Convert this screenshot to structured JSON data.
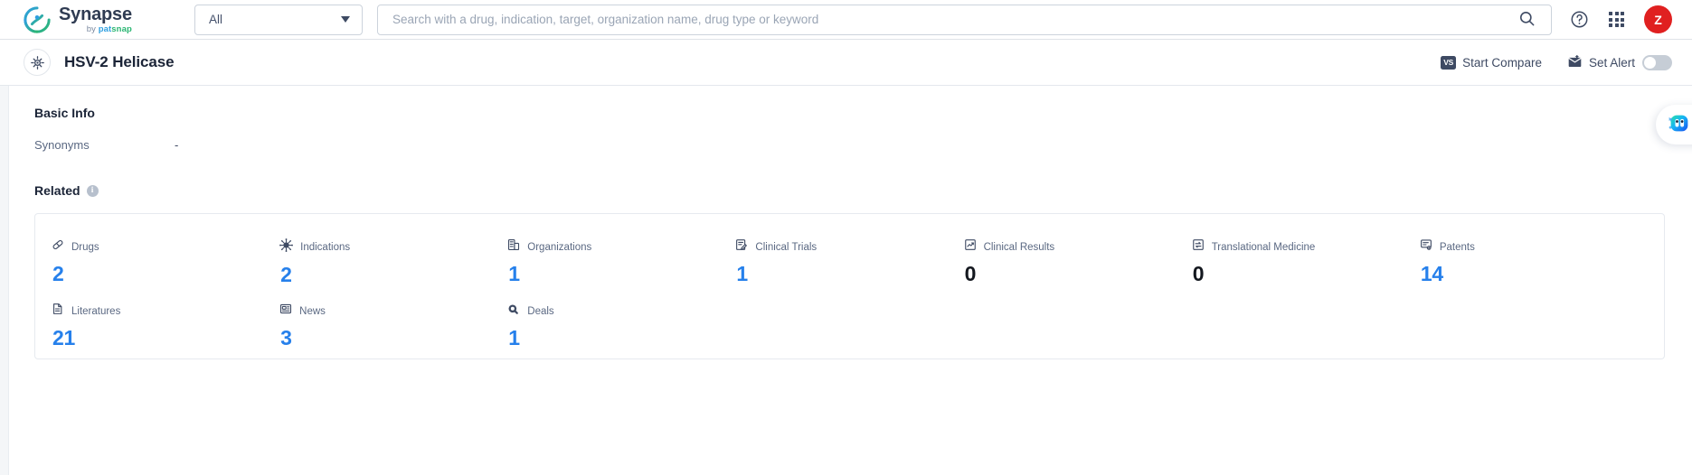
{
  "header": {
    "logo_name": "Synapse",
    "logo_sub_prefix": "by ",
    "logo_sub_brand_a": "pat",
    "logo_sub_brand_b": "snap",
    "scope_selected": "All",
    "search_placeholder": "Search with a drug, indication, target, organization name, drug type or keyword",
    "search_value": "",
    "search_icon": "search-icon",
    "help_icon": "help-circle-icon",
    "apps_icon": "apps-grid-icon",
    "avatar_initial": "Z",
    "avatar_color": "#e02020"
  },
  "titlebar": {
    "entity_icon": "target-crosshair-icon",
    "title": "HSV-2 Helicase",
    "start_compare_label": "Start Compare",
    "start_compare_badge": "VS",
    "set_alert_label": "Set Alert",
    "set_alert_icon": "mail-alert-icon",
    "set_alert_toggle": "off"
  },
  "basic_info": {
    "heading": "Basic Info",
    "rows": [
      {
        "label": "Synonyms",
        "value": "-"
      }
    ]
  },
  "related": {
    "heading": "Related",
    "info_icon": "info-icon",
    "info_glyph": "i",
    "accent_color": "#2680eb",
    "zero_color": "#14181f",
    "stats": [
      {
        "label": "Drugs",
        "value": "2",
        "icon": "pill-icon",
        "is_zero": false
      },
      {
        "label": "Indications",
        "value": "2",
        "icon": "virus-icon",
        "is_zero": false
      },
      {
        "label": "Organizations",
        "value": "1",
        "icon": "building-icon",
        "is_zero": false
      },
      {
        "label": "Clinical Trials",
        "value": "1",
        "icon": "clipboard-edit-icon",
        "is_zero": false
      },
      {
        "label": "Clinical Results",
        "value": "0",
        "icon": "chart-doc-icon",
        "is_zero": true
      },
      {
        "label": "Translational Medicine",
        "value": "0",
        "icon": "transfer-doc-icon",
        "is_zero": true
      },
      {
        "label": "Patents",
        "value": "14",
        "icon": "patent-doc-icon",
        "is_zero": false
      },
      {
        "label": "Literatures",
        "value": "21",
        "icon": "literature-icon",
        "is_zero": false
      },
      {
        "label": "News",
        "value": "3",
        "icon": "news-icon",
        "is_zero": false
      },
      {
        "label": "Deals",
        "value": "1",
        "icon": "deal-handshake-icon",
        "is_zero": false
      }
    ]
  },
  "assistant": {
    "icon": "ai-bot-icon",
    "tooltip": ""
  }
}
